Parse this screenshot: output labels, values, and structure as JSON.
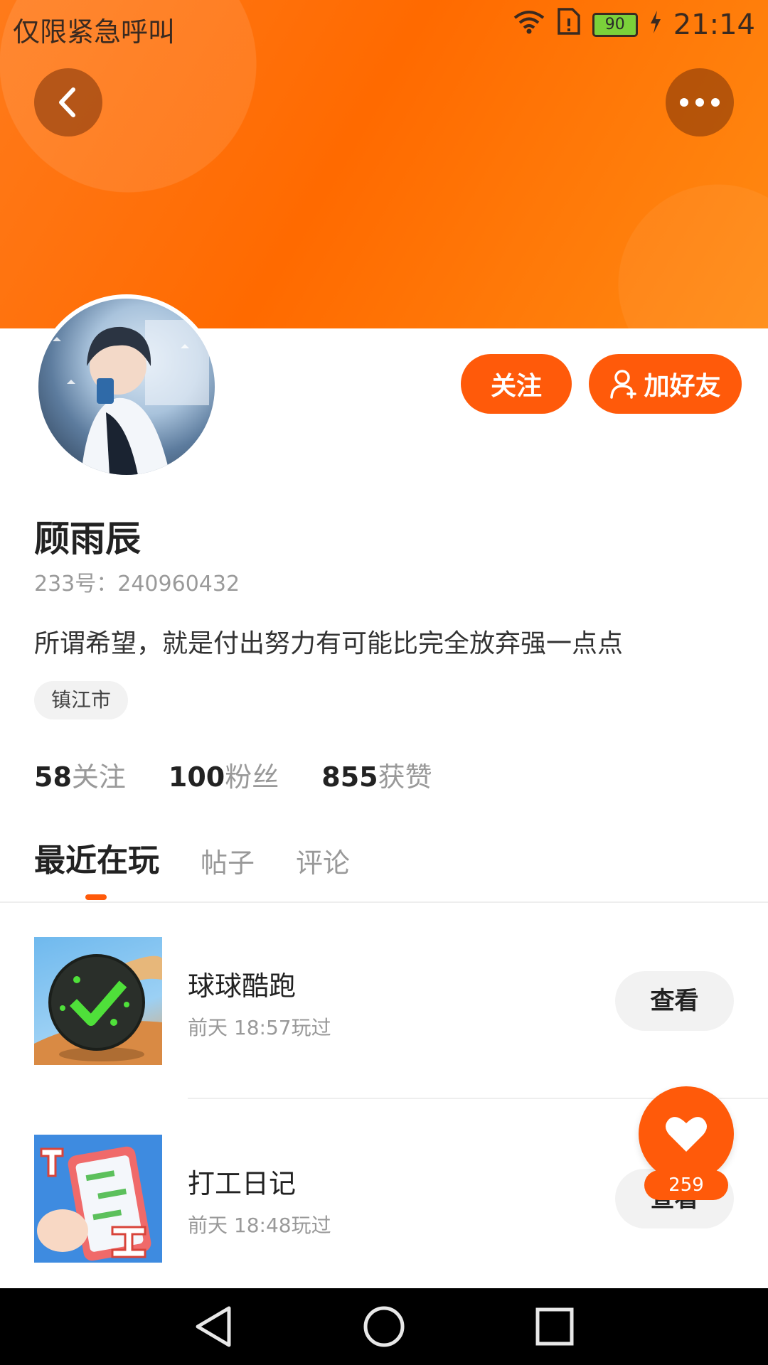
{
  "status_bar": {
    "carrier_text": "仅限紧急呼叫",
    "battery_level": "90",
    "time": "21:14",
    "icons": [
      "wifi-icon",
      "sim-icon",
      "battery-icon",
      "charging-icon"
    ]
  },
  "header": {
    "back_icon": "chevron-left-icon",
    "more_icon": "more-dots-icon"
  },
  "profile": {
    "follow_label": "关注",
    "add_friend_label": "加好友",
    "name": "顾雨辰",
    "id_text": "233号：240960432",
    "bio": "所谓希望，就是付出努力有可能比完全放弃强一点点",
    "location": "镇江市"
  },
  "stats": [
    {
      "num": "58",
      "label": "关注"
    },
    {
      "num": "100",
      "label": "粉丝"
    },
    {
      "num": "855",
      "label": "获赞"
    }
  ],
  "tabs": [
    {
      "label": "最近在玩",
      "active": true
    },
    {
      "label": "帖子",
      "active": false
    },
    {
      "label": "评论",
      "active": false
    }
  ],
  "games": [
    {
      "title": "球球酷跑",
      "subtitle": "前天 18:57玩过",
      "button": "查看"
    },
    {
      "title": "打工日记",
      "subtitle": "前天 18:48玩过",
      "button": "查看"
    }
  ],
  "like": {
    "count": "259"
  },
  "nav_bar": {
    "icons": [
      "nav-back-icon",
      "nav-home-icon",
      "nav-recents-icon"
    ]
  },
  "colors": {
    "accent": "#ff5a0a",
    "banner": "#ff7a1a"
  }
}
